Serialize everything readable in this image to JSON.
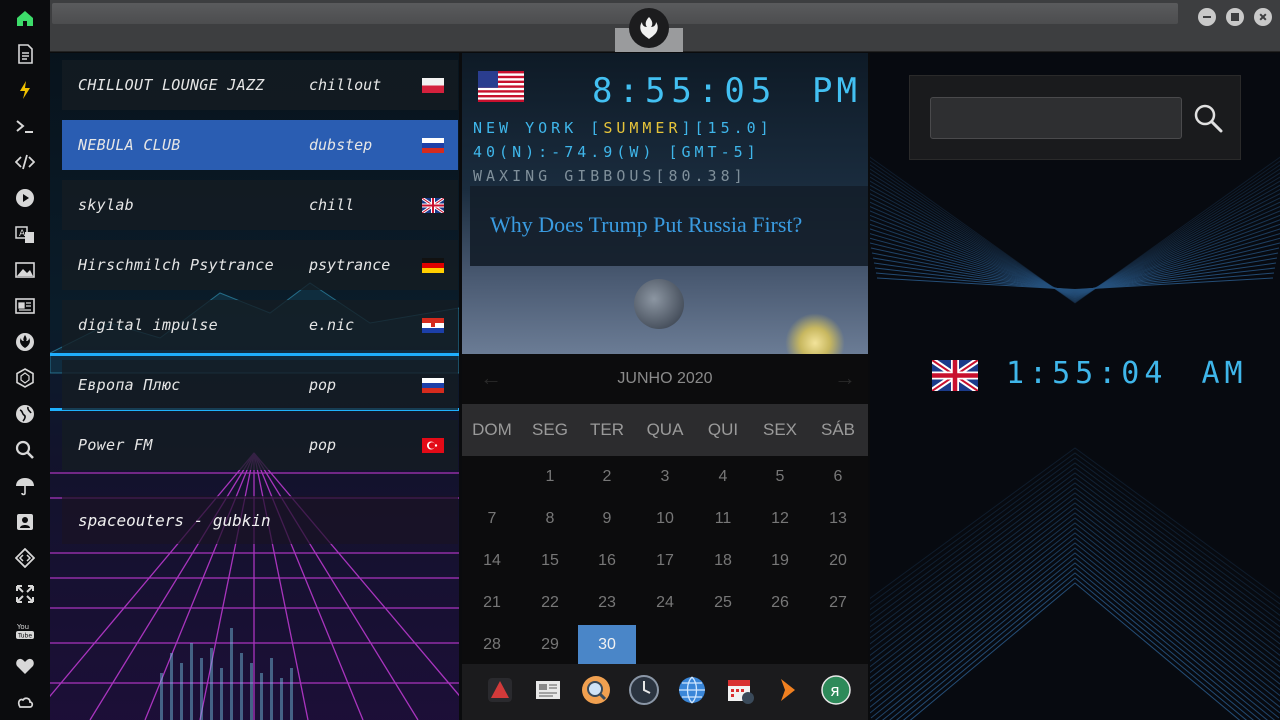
{
  "sidebar": {
    "items": [
      {
        "name": "home-icon",
        "color": "#3ddc6a"
      },
      {
        "name": "document-icon"
      },
      {
        "name": "lightning-icon",
        "color": "#f2c200"
      },
      {
        "name": "terminal-icon"
      },
      {
        "name": "code-icon"
      },
      {
        "name": "play-icon"
      },
      {
        "name": "translate-icon"
      },
      {
        "name": "image-icon"
      },
      {
        "name": "newspaper-icon"
      },
      {
        "name": "rebel-icon"
      },
      {
        "name": "hexagon-icon"
      },
      {
        "name": "globe-icon"
      },
      {
        "name": "search-icon"
      },
      {
        "name": "umbrella-icon"
      },
      {
        "name": "contact-icon"
      },
      {
        "name": "diamond-code-icon"
      },
      {
        "name": "expand-icon"
      },
      {
        "name": "youtube-icon",
        "label": "You\nTube"
      },
      {
        "name": "heart-icon"
      },
      {
        "name": "cloud-icon"
      }
    ]
  },
  "stations": [
    {
      "name": "CHILLOUT LOUNGE JAZZ",
      "genre": "chillout",
      "flag": "pl"
    },
    {
      "name": "NEBULA CLUB",
      "genre": "dubstep",
      "flag": "ru",
      "active": true
    },
    {
      "name": "skylab",
      "genre": "chill",
      "flag": "uk"
    },
    {
      "name": "Hirschmilch Psytrance",
      "genre": "psytrance",
      "flag": "de"
    },
    {
      "name": "digital impulse",
      "genre": "e.nic",
      "flag": "hr"
    },
    {
      "name": "Европа Плюс",
      "genre": "pop",
      "flag": "ru"
    },
    {
      "name": "Power FM",
      "genre": "pop",
      "flag": "tr"
    }
  ],
  "now_playing": "spaceouters - gubkin",
  "clock": {
    "time": "8:55:05",
    "ampm": "PM",
    "line1_pre": "NEW YORK [",
    "line1_season": "SUMMER",
    "line1_post": "][15.0]",
    "line2": "40(N):-74.9(W) [GMT-5]",
    "line3": "WAXING GIBBOUS[80.38]"
  },
  "news": {
    "headline": "Why Does Trump Put Russia First?"
  },
  "calendar": {
    "month_label": "JUNHO 2020",
    "prev": "←",
    "next": "→",
    "weekdays": [
      "DOM",
      "SEG",
      "TER",
      "QUA",
      "QUI",
      "SEX",
      "SÁB"
    ],
    "weeks": [
      [
        "",
        "1",
        "2",
        "3",
        "4",
        "5",
        "6"
      ],
      [
        "7",
        "8",
        "9",
        "10",
        "11",
        "12",
        "13"
      ],
      [
        "14",
        "15",
        "16",
        "17",
        "18",
        "19",
        "20"
      ],
      [
        "21",
        "22",
        "23",
        "24",
        "25",
        "26",
        "27"
      ],
      [
        "28",
        "29",
        "30",
        "",
        "",
        "",
        ""
      ]
    ],
    "today": "30"
  },
  "dock": [
    {
      "name": "vpn-icon",
      "color": "#d23a3a"
    },
    {
      "name": "news-icon",
      "color": "#cfcfcf"
    },
    {
      "name": "search-app-icon",
      "color": "#f0a050"
    },
    {
      "name": "clock-app-icon",
      "color": "#6f7d8e"
    },
    {
      "name": "web-icon",
      "color": "#3a86d8"
    },
    {
      "name": "calendar-app-icon",
      "color": "#e0e0e0"
    },
    {
      "name": "next-icon",
      "color": "#f08020"
    },
    {
      "name": "yandex-icon",
      "color": "#2e8a5a"
    }
  ],
  "uk_clock": {
    "time": "1:55:04",
    "ampm": "AM"
  },
  "search": {
    "value": "",
    "placeholder": ""
  },
  "colors": {
    "accent": "#2a5db2",
    "lcd": "#3fb6ea",
    "today": "#4a86c8"
  }
}
